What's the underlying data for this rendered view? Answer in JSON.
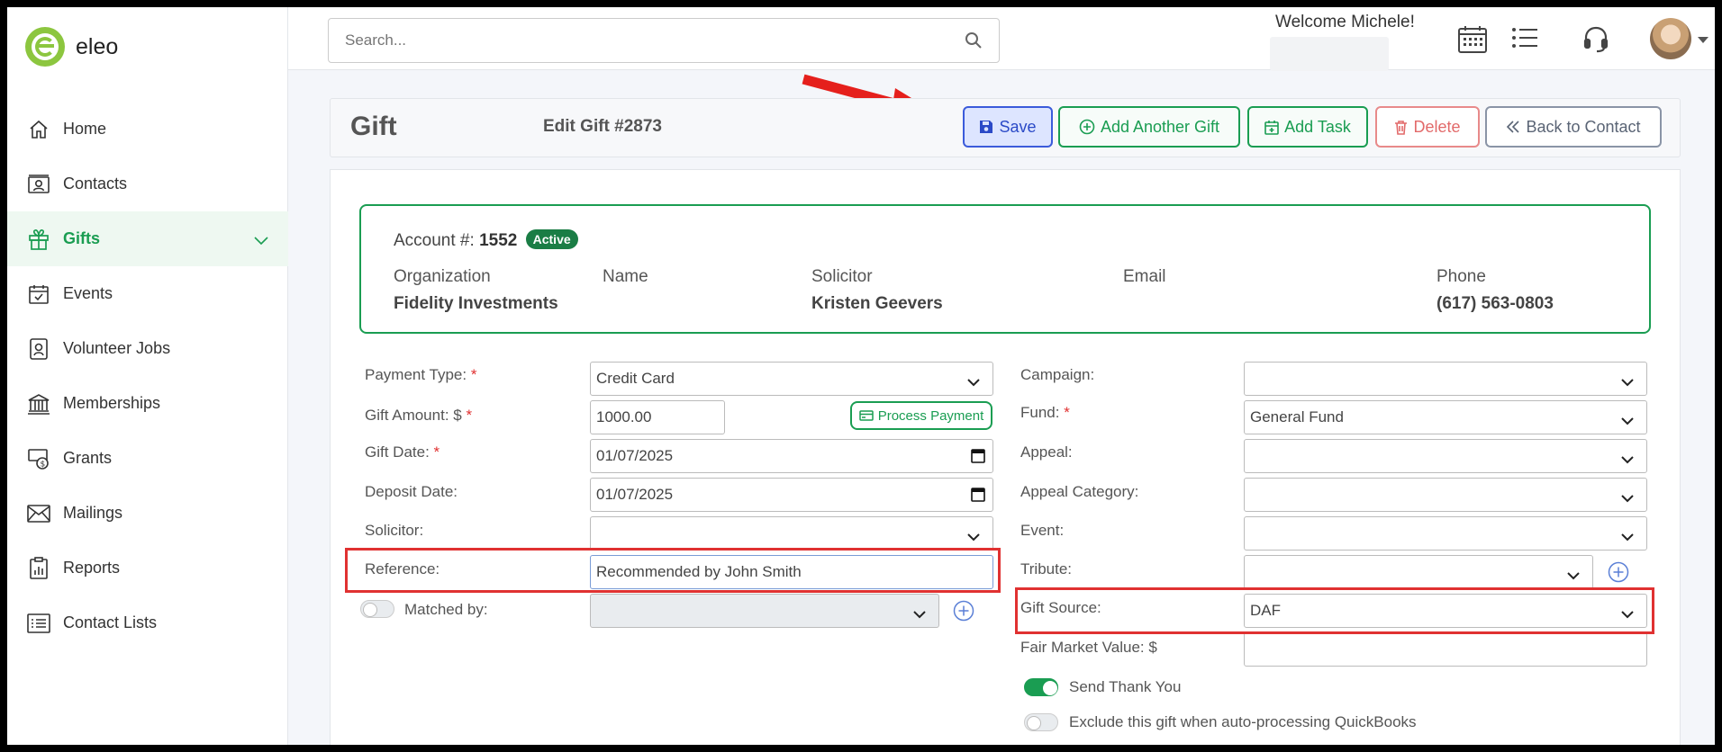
{
  "app": {
    "name": "eleo"
  },
  "sidebar": {
    "items": [
      {
        "label": "Home",
        "icon": "home-icon"
      },
      {
        "label": "Contacts",
        "icon": "contacts-icon"
      },
      {
        "label": "Gifts",
        "icon": "gift-icon",
        "active": true
      },
      {
        "label": "Events",
        "icon": "calendar-check-icon"
      },
      {
        "label": "Volunteer Jobs",
        "icon": "badge-icon"
      },
      {
        "label": "Memberships",
        "icon": "bank-icon"
      },
      {
        "label": "Grants",
        "icon": "money-icon"
      },
      {
        "label": "Mailings",
        "icon": "envelope-icon"
      },
      {
        "label": "Reports",
        "icon": "report-icon"
      },
      {
        "label": "Contact Lists",
        "icon": "list-icon"
      }
    ]
  },
  "topbar": {
    "search_placeholder": "Search...",
    "welcome": "Welcome Michele!"
  },
  "header": {
    "title": "Gift",
    "subtitle": "Edit Gift #2873",
    "buttons": {
      "save": "Save",
      "add_gift": "Add Another Gift",
      "add_task": "Add Task",
      "delete": "Delete",
      "back": "Back to Contact"
    }
  },
  "account": {
    "label": "Account #:",
    "number": "1552",
    "status": "Active",
    "organization_label": "Organization",
    "organization": "Fidelity Investments",
    "name_label": "Name",
    "name": "",
    "solicitor_label": "Solicitor",
    "solicitor": "Kristen Geevers",
    "email_label": "Email",
    "email": "",
    "phone_label": "Phone",
    "phone": "(617) 563-0803"
  },
  "form": {
    "payment_type_label": "Payment Type:",
    "payment_type": "Credit Card",
    "gift_amount_label": "Gift Amount: $",
    "gift_amount": "1000.00",
    "process_payment": "Process Payment",
    "gift_date_label": "Gift Date:",
    "gift_date": "01/07/2025",
    "deposit_date_label": "Deposit Date:",
    "deposit_date": "01/07/2025",
    "solicitor_label": "Solicitor:",
    "solicitor": "",
    "reference_label": "Reference:",
    "reference": "Recommended by John Smith",
    "matched_by_label": "Matched by:",
    "campaign_label": "Campaign:",
    "campaign": "",
    "fund_label": "Fund:",
    "fund": "General Fund",
    "appeal_label": "Appeal:",
    "appeal": "",
    "appeal_category_label": "Appeal Category:",
    "appeal_category": "",
    "event_label": "Event:",
    "event": "",
    "tribute_label": "Tribute:",
    "tribute": "",
    "gift_source_label": "Gift Source:",
    "gift_source": "DAF",
    "fair_market_label": "Fair Market Value: $",
    "fair_market": "",
    "send_thank_you_label": "Send Thank You",
    "send_thank_you": true,
    "exclude_qb_label": "Exclude this gift when auto-processing QuickBooks",
    "exclude_qb": false,
    "required_mark": "*"
  },
  "colors": {
    "accent": "#1a9d52",
    "save": "#3b5bdb",
    "danger": "#e03131"
  }
}
